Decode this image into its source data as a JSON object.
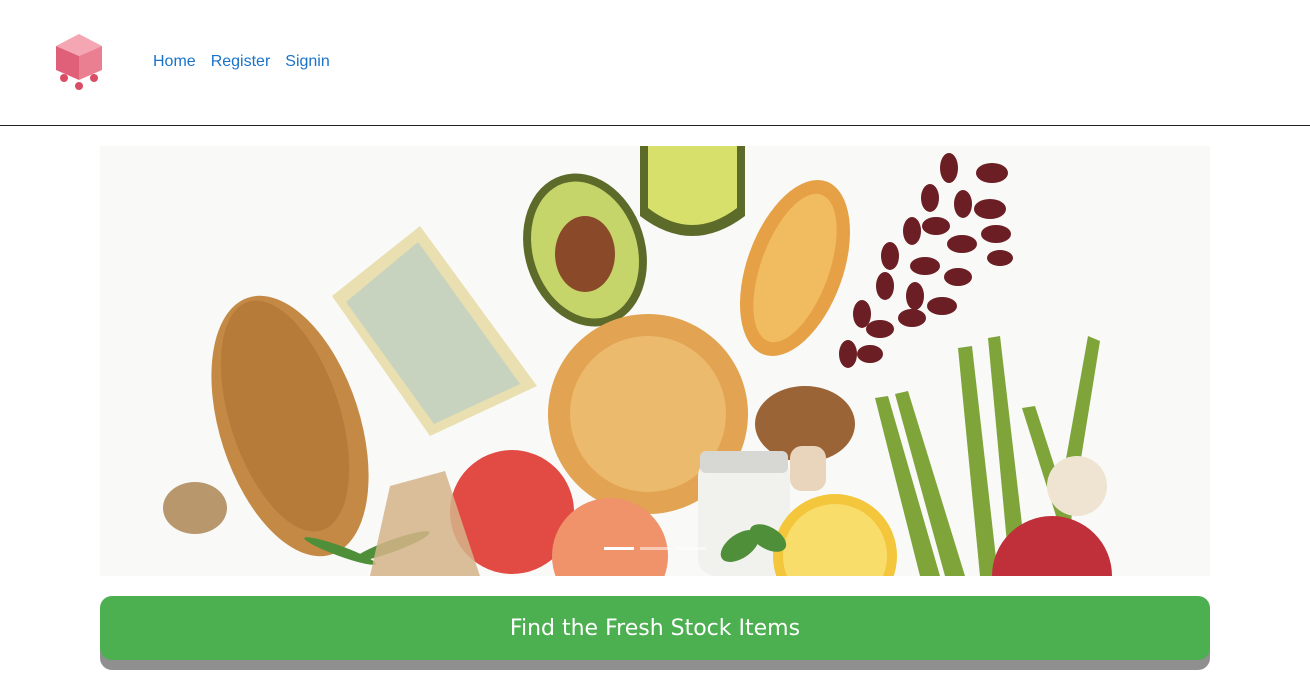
{
  "header": {
    "logo_icon": "shopping-cart-box-icon",
    "nav_links": [
      {
        "label": "Home"
      },
      {
        "label": "Register"
      },
      {
        "label": "Signin"
      }
    ],
    "link_color": "#1a73c9"
  },
  "hero": {
    "image_subject": "fresh-groceries-image",
    "slides_total": 3,
    "active_slide": 1
  },
  "cta": {
    "label": "Find the Fresh Stock Items",
    "color": "#4caf50"
  }
}
